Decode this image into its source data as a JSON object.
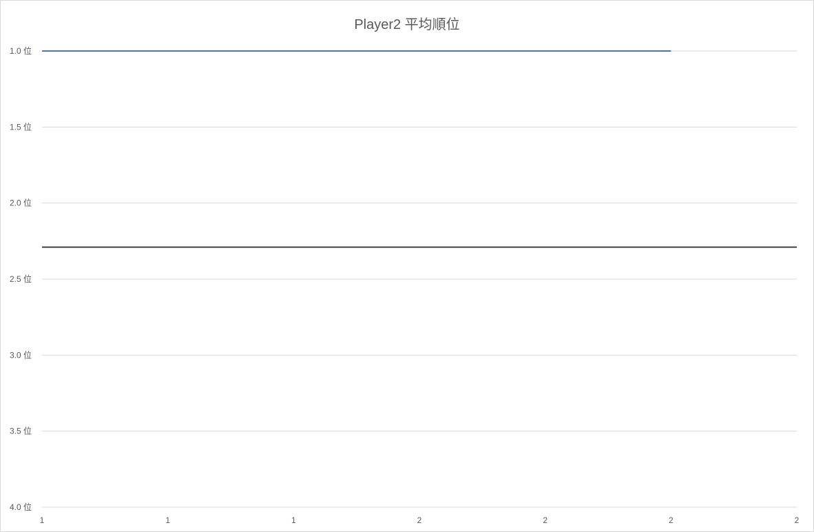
{
  "chart_data": {
    "type": "line",
    "title": "Player2 平均順位",
    "xlabel": "",
    "ylabel": "",
    "x_tick_labels": [
      "1",
      "1",
      "1",
      "2",
      "2",
      "2",
      "2"
    ],
    "y_tick_labels": [
      "1.0 位",
      "1.5 位",
      "2.0 位",
      "2.5 位",
      "3.0 位",
      "3.5 位",
      "4.0 位"
    ],
    "ylim": [
      1.0,
      4.0
    ],
    "y_reversed": true,
    "grid": true,
    "legend": "none",
    "series": [
      {
        "x_index": [
          0,
          5
        ],
        "values": [
          1.0,
          1.0
        ],
        "color": "#4472c4"
      },
      {
        "x_index": [
          0,
          6
        ],
        "values": [
          2.29,
          2.29
        ],
        "color": "#404040"
      }
    ],
    "gridline_color": "#d9d9d9"
  }
}
